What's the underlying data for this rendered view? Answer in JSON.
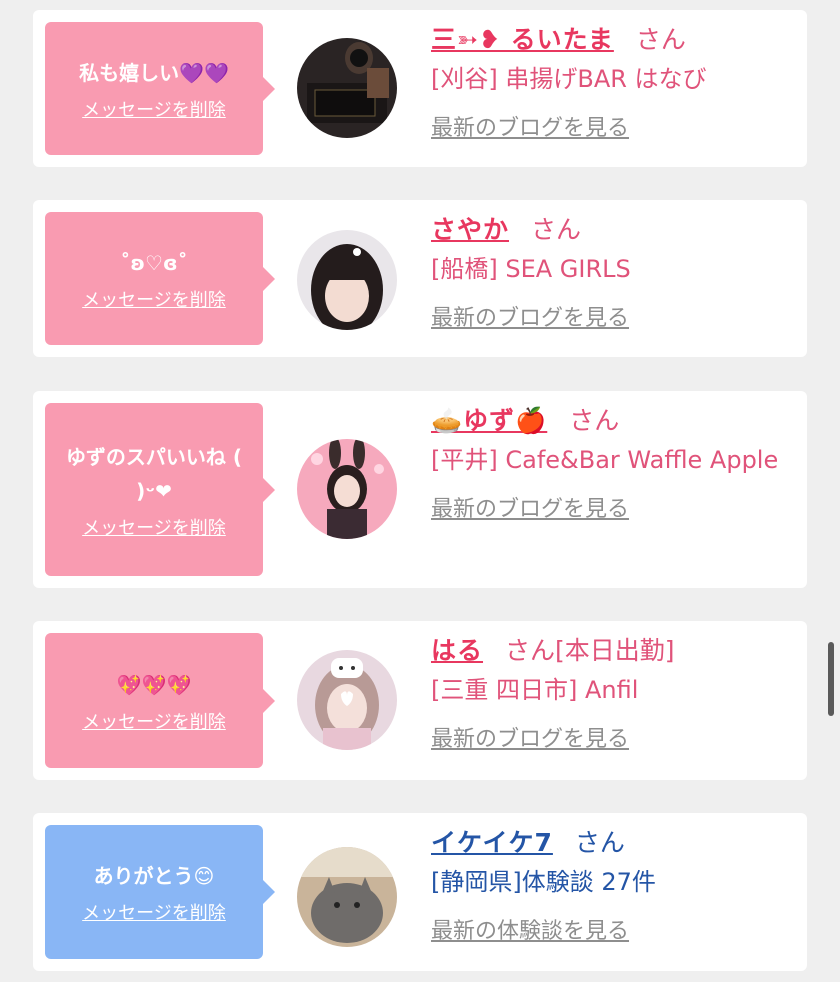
{
  "cards": [
    {
      "message": "私も嬉しい💜💜",
      "delete_label": "メッセージを削除",
      "name": "三➳❥ るいたま",
      "san": "さん",
      "shop": "[刈谷] 串揚げBAR はなび",
      "blog_link": "最新のブログを見る",
      "bubble_color": "#f99bb1"
    },
    {
      "message": "˚ʚ♡ɞ˚",
      "delete_label": "メッセージを削除",
      "name": "さやか",
      "san": "さん",
      "shop": "[船橋] SEA GIRLS",
      "blog_link": "最新のブログを見る",
      "bubble_color": "#f99bb1"
    },
    {
      "message": "ゆずのスパいいね ( )ᵕ❤︎",
      "delete_label": "メッセージを削除",
      "name": "🥧ゆず🍎",
      "san": "さん",
      "shop": "[平井] Cafe&Bar Waffle Apple",
      "blog_link": "最新のブログを見る",
      "bubble_color": "#f99bb1"
    },
    {
      "message": "💖💖💖",
      "delete_label": "メッセージを削除",
      "name": "はる",
      "san": "さん[本日出勤]",
      "shop": "[三重 四日市] Anfil",
      "blog_link": "最新のブログを見る",
      "bubble_color": "#f99bb1"
    },
    {
      "message": "ありがとう😊",
      "delete_label": "メッセージを削除",
      "name": "イケイケ7",
      "san": "さん",
      "shop": "[静岡県]体験談 27件",
      "blog_link": "最新の体験談を見る",
      "bubble_color": "#89b6f5"
    }
  ]
}
